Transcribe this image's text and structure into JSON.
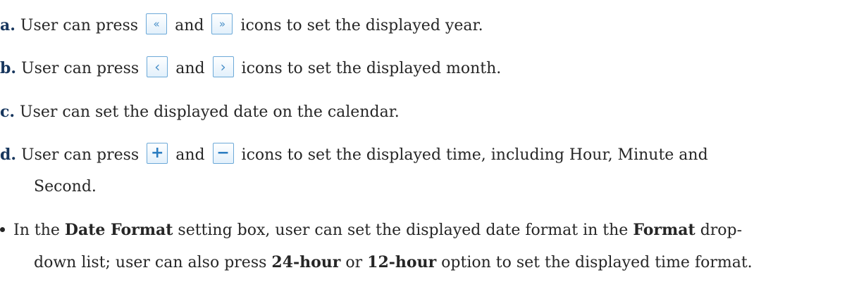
{
  "items": {
    "a": {
      "marker": "a.",
      "t1": " User can press ",
      "icon1": "«",
      "t2": " and ",
      "icon2": "»",
      "t3": " icons to set the displayed year."
    },
    "b": {
      "marker": "b.",
      "t1": " User can press ",
      "icon1": "‹",
      "t2": " and ",
      "icon2": "›",
      "t3": " icons to set the displayed month."
    },
    "c": {
      "marker": "c.",
      "t1": " User can set the displayed date on the calendar."
    },
    "d": {
      "marker": "d.",
      "t1": " User can press ",
      "icon1": "+",
      "t2": " and ",
      "icon2": "−",
      "t3": " icons to set the displayed time, including Hour, Minute and",
      "t4": "Second."
    }
  },
  "bullet": {
    "p1": "In the ",
    "b1": "Date Format",
    "p2": " setting box, user can set the displayed date format in the ",
    "b2": "Format",
    "p3": " drop-",
    "p4": "down list; user can also press ",
    "b3": "24-hour",
    "p5": " or ",
    "b4": "12-hour",
    "p6": " option to set the displayed time format."
  },
  "icons": [
    "year-prev-icon",
    "year-next-icon",
    "month-prev-icon",
    "month-next-icon",
    "plus-icon",
    "minus-icon"
  ],
  "colors": {
    "marker": "#17365d",
    "icon_border": "#6ca9d8",
    "icon_glyph": "#4a90c8"
  }
}
